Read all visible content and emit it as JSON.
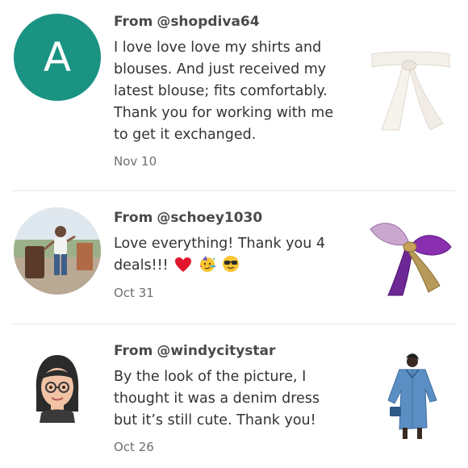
{
  "reviews": [
    {
      "from_prefix": "From",
      "username": "@shopdiva64",
      "avatar_letter": "A",
      "avatar_color": "#1a9383",
      "text": "I love love love my shirts and blouses. And just received my latest blouse; fits comfortably. Thank you for working with me to get it exchanged.",
      "date": "Nov 10"
    },
    {
      "from_prefix": "From",
      "username": "@schoey1030",
      "text": "Love everything! Thank you 4 deals!!!",
      "emojis": [
        "red-heart-emoji",
        "party-face-emoji",
        "sunglasses-face-emoji"
      ],
      "date": "Oct 31"
    },
    {
      "from_prefix": "From",
      "username": "@windycitystar",
      "text": "By the look of the picture, I thought it was a denim dress but it’s still cute. Thank you!",
      "date": "Oct 26"
    }
  ]
}
